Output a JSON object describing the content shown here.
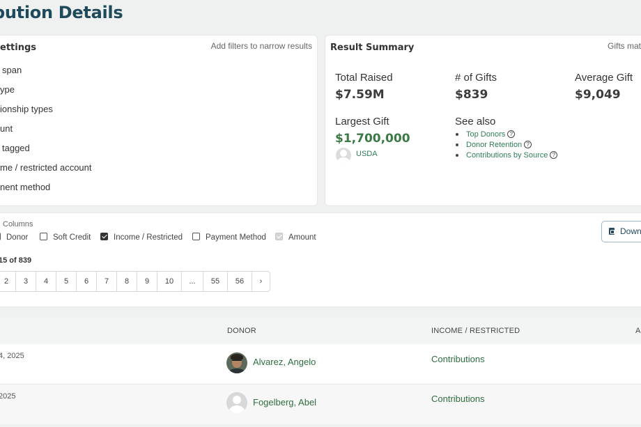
{
  "page": {
    "title": "bution Details"
  },
  "settings": {
    "heading": "ettings",
    "hint": "Add filters to narrow results",
    "items": [
      "span",
      "ype",
      "ionship types",
      "unt",
      "tagged",
      "me / restricted account",
      "nent method"
    ]
  },
  "summary": {
    "heading": "Result Summary",
    "hint": "Gifts matc",
    "total_raised_label": "Total Raised",
    "total_raised_value": "$7.59M",
    "gifts_label": "# of Gifts",
    "gifts_value": "$839",
    "avg_label": "Average Gift",
    "avg_value": "$9,049",
    "largest_label": "Largest Gift",
    "largest_value": "$1,700,000",
    "largest_donor": "USDA",
    "see_also_label": "See also",
    "see_also_links": [
      "Top Donors",
      "Donor Retention",
      "Contributions by Source"
    ]
  },
  "columns": {
    "label": "Columns",
    "options": [
      {
        "label": "Donor",
        "state": "unchecked"
      },
      {
        "label": "Soft Credit",
        "state": "unchecked"
      },
      {
        "label": "Income / Restricted",
        "state": "checked"
      },
      {
        "label": "Payment Method",
        "state": "unchecked"
      },
      {
        "label": "Amount",
        "state": "disabled"
      }
    ]
  },
  "results_count": "15 of 839",
  "download_label": "Down",
  "pagination": [
    "2",
    "3",
    "4",
    "5",
    "6",
    "7",
    "8",
    "9",
    "10",
    "...",
    "55",
    "56",
    "›"
  ],
  "table": {
    "headers": {
      "donor": "DONOR",
      "income": "INCOME / RESTRICTED",
      "amount": "A"
    },
    "rows": [
      {
        "date": "4, 2025",
        "donor": "Alvarez, Angelo",
        "income": "Contributions"
      },
      {
        "date": "2025",
        "donor": "Fogelberg, Abel",
        "income": "Contributions"
      }
    ]
  }
}
